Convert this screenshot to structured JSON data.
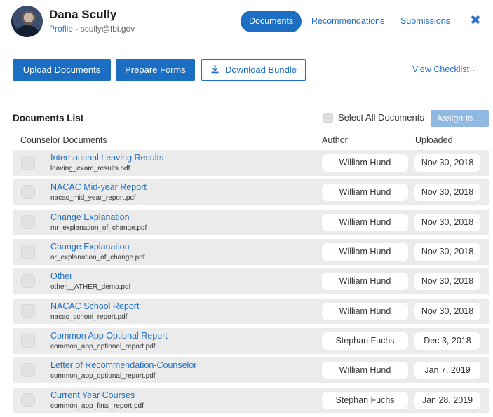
{
  "user": {
    "name": "Dana Scully",
    "profile_label": "Profile",
    "separator": " - ",
    "email": "scully@fbi.gov"
  },
  "nav": {
    "tabs": [
      {
        "label": "Documents",
        "active": true
      },
      {
        "label": "Recommendations",
        "active": false
      },
      {
        "label": "Submissions",
        "active": false
      }
    ],
    "close_icon": "close-icon"
  },
  "toolbar": {
    "upload_label": "Upload Documents",
    "prepare_label": "Prepare Forms",
    "download_label": "Download Bundle",
    "download_icon": "download-icon",
    "view_checklist_label": "View Checklist",
    "chevron": "chevron-down-icon"
  },
  "list": {
    "title": "Documents List",
    "select_all_label": "Select All Documents",
    "assign_label": "Assign to ...",
    "columns": [
      "Counselor Documents",
      "Author",
      "Uploaded"
    ],
    "rows": [
      {
        "title": "International Leaving Results",
        "file": "leaving_exam_results.pdf",
        "author": "William Hund",
        "uploaded": "Nov 30, 2018"
      },
      {
        "title": "NACAC Mid-year Report",
        "file": "nacac_mid_year_report.pdf",
        "author": "William Hund",
        "uploaded": "Nov 30, 2018"
      },
      {
        "title": "Change Explanation",
        "file": "mr_explanation_of_change.pdf",
        "author": "William Hund",
        "uploaded": "Nov 30, 2018"
      },
      {
        "title": "Change Explanation",
        "file": "or_explanation_of_change.pdf",
        "author": "William Hund",
        "uploaded": "Nov 30, 2018"
      },
      {
        "title": "Other",
        "file": "other__ATHER_demo.pdf",
        "author": "William Hund",
        "uploaded": "Nov 30, 2018"
      },
      {
        "title": "NACAC School Report",
        "file": "nacac_school_report.pdf",
        "author": "William Hund",
        "uploaded": "Nov 30, 2018"
      },
      {
        "title": "Common App Optional Report",
        "file": "common_app_optional_report.pdf",
        "author": "Stephan Fuchs",
        "uploaded": "Dec 3, 2018"
      },
      {
        "title": "Letter of Recommendation-Counselor",
        "file": "common_app_optional_report.pdf",
        "author": "William Hund",
        "uploaded": "Jan 7, 2019"
      },
      {
        "title": "Current Year Courses",
        "file": "common_app_final_report.pdf",
        "author": "Stephan Fuchs",
        "uploaded": "Jan 28, 2019"
      }
    ]
  },
  "colors": {
    "accent": "#1b6ec2",
    "link": "#1f6fc3",
    "row_bg": "#ebebeb",
    "assign_disabled": "#8fb9e3"
  }
}
